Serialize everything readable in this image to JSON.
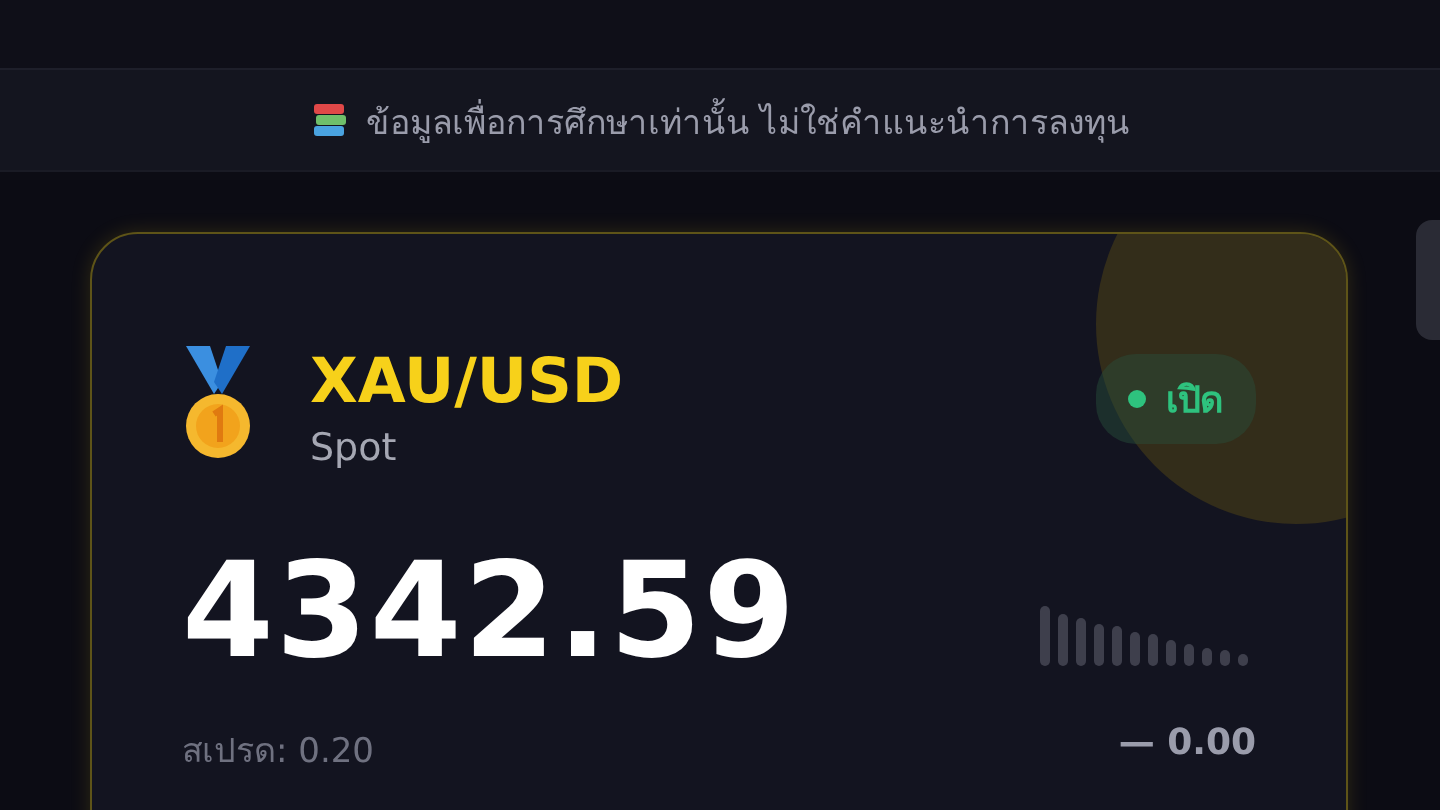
{
  "banner": {
    "text": "ข้อมูลเพื่อการศึกษาเท่านั้น ไม่ใช่คำแนะนำการลงทุน"
  },
  "card": {
    "symbol": "XAU/USD",
    "type": "Spot",
    "status": {
      "label": "เปิด",
      "open": true
    },
    "price": "4342.59",
    "spread": "สเปรด: 0.20",
    "change": "— 0.00"
  }
}
